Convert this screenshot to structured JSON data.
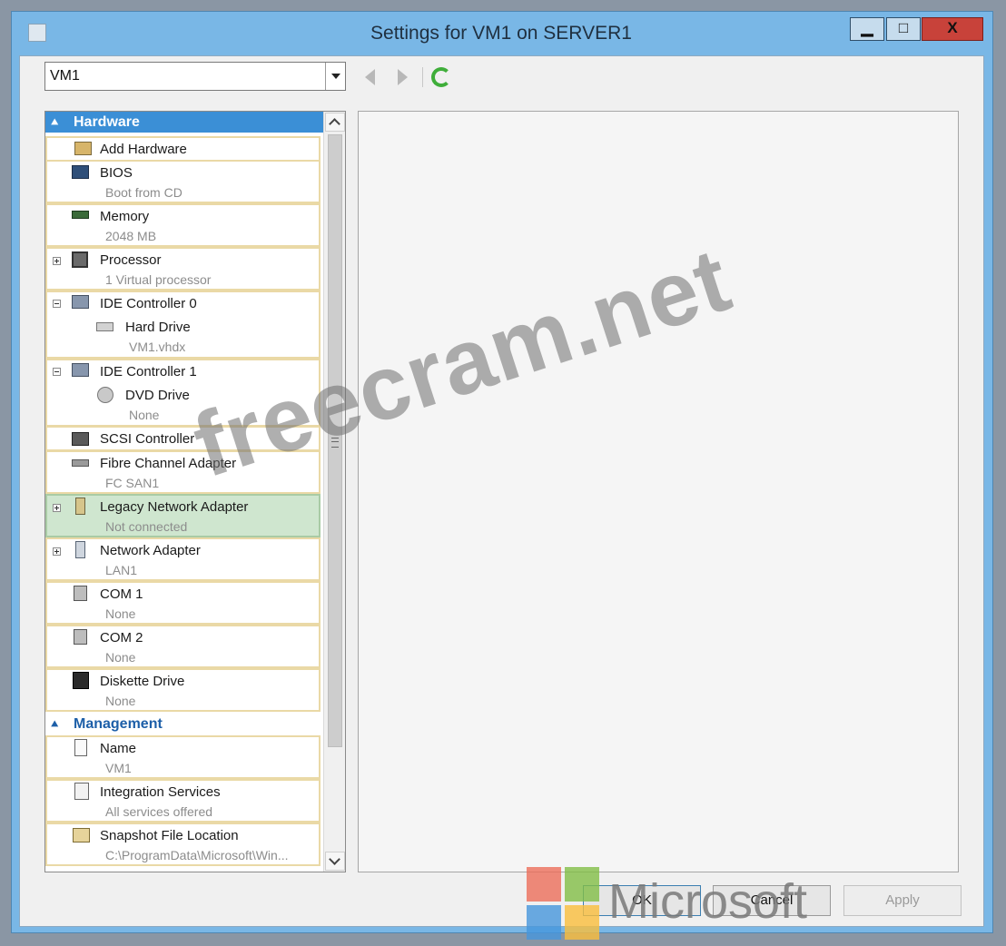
{
  "window": {
    "title": "Settings for VM1 on SERVER1",
    "controls": {
      "minimize": "▁",
      "maximize": "□",
      "close": "X"
    }
  },
  "toolbar": {
    "vm_selector_value": "VM1"
  },
  "sections": {
    "hardware": "Hardware",
    "management": "Management"
  },
  "hardware_items": {
    "add_hardware": {
      "name": "Add Hardware"
    },
    "bios": {
      "name": "BIOS",
      "detail": "Boot from CD"
    },
    "memory": {
      "name": "Memory",
      "detail": "2048 MB"
    },
    "processor": {
      "name": "Processor",
      "detail": "1 Virtual processor"
    },
    "ide0": {
      "name": "IDE Controller 0",
      "child_name": "Hard Drive",
      "child_detail": "VM1.vhdx"
    },
    "ide1": {
      "name": "IDE Controller 1",
      "child_name": "DVD Drive",
      "child_detail": "None"
    },
    "scsi": {
      "name": "SCSI Controller"
    },
    "fibre": {
      "name": "Fibre Channel Adapter",
      "detail": "FC SAN1"
    },
    "legacy_nic": {
      "name": "Legacy Network Adapter",
      "detail": "Not connected"
    },
    "nic": {
      "name": "Network Adapter",
      "detail": "LAN1"
    },
    "com1": {
      "name": "COM 1",
      "detail": "None"
    },
    "com2": {
      "name": "COM 2",
      "detail": "None"
    },
    "diskette": {
      "name": "Diskette Drive",
      "detail": "None"
    }
  },
  "management_items": {
    "name": {
      "name": "Name",
      "detail": "VM1"
    },
    "integration": {
      "name": "Integration Services",
      "detail": "All services offered"
    },
    "snapshot": {
      "name": "Snapshot File Location",
      "detail": "C:\\ProgramData\\Microsoft\\Win..."
    }
  },
  "buttons": {
    "ok": "OK",
    "cancel": "Cancel",
    "apply": "Apply"
  },
  "overlays": {
    "watermark": "freecram.net",
    "logo_text": "Microsoft"
  },
  "colors": {
    "title_bar": "#79b7e6",
    "hardware_header": "#3b8fd6",
    "selected_item": "#cfe6cf",
    "close_button": "#c8423a"
  }
}
